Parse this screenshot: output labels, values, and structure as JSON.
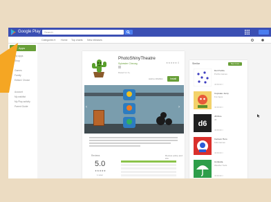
{
  "header": {
    "brand": "Google Play",
    "search_placeholder": "Search"
  },
  "category_bar": {
    "items": [
      "Categories ▾",
      "Home",
      "Top charts",
      "New releases"
    ]
  },
  "sidebar": {
    "active_label": "Apps",
    "items": [
      "My apps",
      "Shop",
      "Games",
      "Family",
      "Editors' Choice",
      "Account",
      "My wishlist",
      "My Play activity",
      "Parent Guide"
    ]
  },
  "app": {
    "title": "PhotoShinyTheatre",
    "developer": "Sylvester Cheung",
    "rated": "Rated for 3+",
    "stars": "★★★★★ 0",
    "wishlist_label": "Add to Wishlist",
    "install_label": "Install"
  },
  "reviews": {
    "label": "Reviews",
    "more_label": "Review policy and info",
    "score": "5.0",
    "stars": "★★★★★",
    "count": "1 total",
    "distribution": [
      1.0,
      0.0,
      0.0,
      0.0,
      0.0
    ]
  },
  "similar": {
    "title": "Similar",
    "see_more": "See more",
    "items": [
      {
        "name": "Dot Puzzle",
        "developer": "Puzzle Games",
        "stars": "★★★★☆",
        "icon": "dots-puzzle-icon"
      },
      {
        "name": "Cupcake Jump",
        "developer": "Fun Apps",
        "stars": "★★★★☆",
        "icon": "character-game-icon"
      },
      {
        "name": "d6 Dice",
        "developer": "d6",
        "stars": "★★★★☆",
        "icon": "d6-icon"
      },
      {
        "name": "Cartoon Hero",
        "developer": "Kids Games",
        "stars": "★★★★☆",
        "icon": "cartoon-hero-icon"
      },
      {
        "name": "Umbrella",
        "developer": "Weather Tools",
        "stars": "★★★★☆",
        "icon": "umbrella-icon"
      }
    ]
  },
  "colors": {
    "page_background": "#ecdcc2",
    "header_blue": "#3b4fb3",
    "play_green": "#689f38",
    "accent_orange": "#f5a623"
  }
}
